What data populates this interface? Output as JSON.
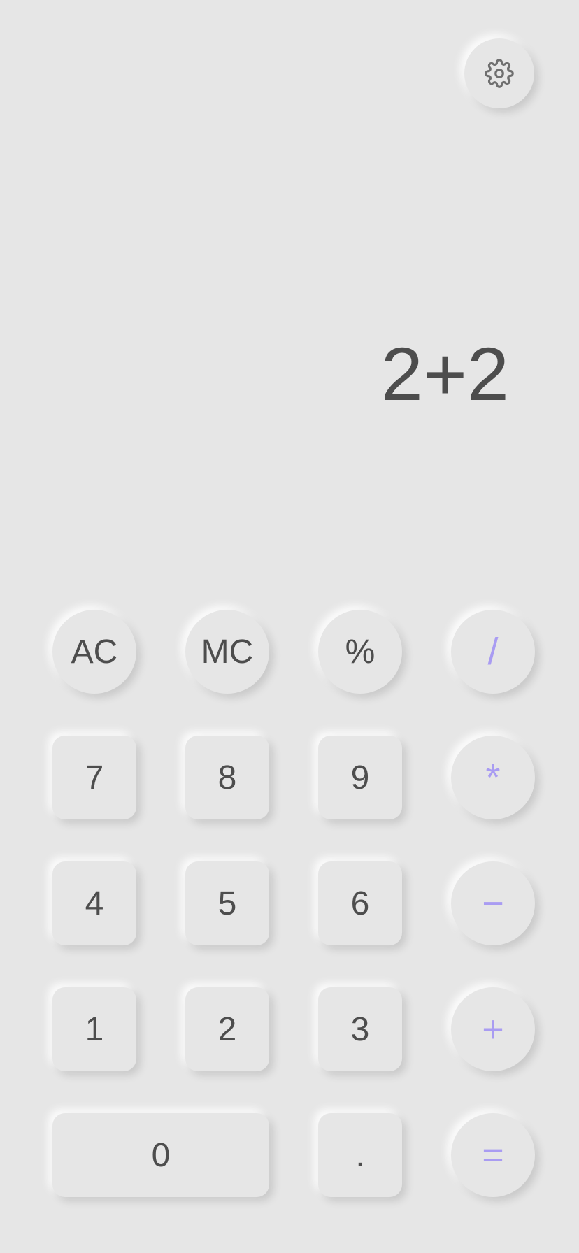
{
  "display": {
    "expression": "2+2"
  },
  "settings": {
    "icon": "gear-icon"
  },
  "colors": {
    "background": "#e6e6e6",
    "text": "#4d4d4d",
    "operator_accent": "#a99cf2"
  },
  "keys": {
    "ac": "AC",
    "mc": "MC",
    "percent": "%",
    "divide": "/",
    "seven": "7",
    "eight": "8",
    "nine": "9",
    "multiply": "*",
    "four": "4",
    "five": "5",
    "six": "6",
    "minus": "−",
    "one": "1",
    "two": "2",
    "three": "3",
    "plus": "+",
    "zero": "0",
    "decimal": ".",
    "equals": "="
  }
}
